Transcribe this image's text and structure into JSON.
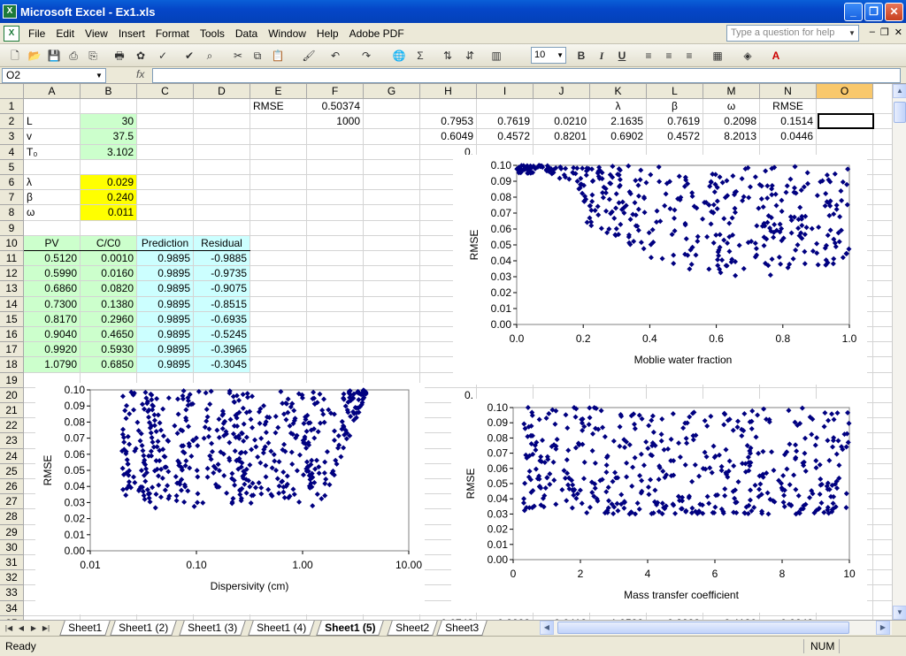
{
  "window": {
    "title": "Microsoft Excel - Ex1.xls",
    "icon": "excel-icon"
  },
  "menu": [
    "File",
    "Edit",
    "View",
    "Insert",
    "Format",
    "Tools",
    "Data",
    "Window",
    "Help",
    "Adobe PDF"
  ],
  "ask_placeholder": "Type a question for help",
  "toolbar": {
    "font_size": "10",
    "bold": "B",
    "italic": "I",
    "underline": "U",
    "sum": "Σ"
  },
  "formula": {
    "name_box": "O2",
    "fx": "fx",
    "content": ""
  },
  "columns": [
    "A",
    "B",
    "C",
    "D",
    "E",
    "F",
    "G",
    "H",
    "I",
    "J",
    "K",
    "L",
    "M",
    "N",
    "O"
  ],
  "selected_column": "O",
  "cells": [
    {
      "ref": "E1",
      "text": "RMSE"
    },
    {
      "ref": "F1",
      "text": "0.50374",
      "align": "r"
    },
    {
      "ref": "K1",
      "text": "λ",
      "align": "c"
    },
    {
      "ref": "L1",
      "text": "β",
      "align": "c"
    },
    {
      "ref": "M1",
      "text": "ω",
      "align": "c"
    },
    {
      "ref": "N1",
      "text": "RMSE",
      "align": "c"
    },
    {
      "ref": "A2",
      "text": "L"
    },
    {
      "ref": "B2",
      "text": "30",
      "align": "r",
      "fill": "#ccffcc"
    },
    {
      "ref": "F2",
      "text": "1000",
      "align": "r"
    },
    {
      "ref": "H2",
      "text": "0.7953",
      "align": "r"
    },
    {
      "ref": "I2",
      "text": "0.7619",
      "align": "r"
    },
    {
      "ref": "J2",
      "text": "0.0210",
      "align": "r"
    },
    {
      "ref": "K2",
      "text": "2.1635",
      "align": "r"
    },
    {
      "ref": "L2",
      "text": "0.7619",
      "align": "r"
    },
    {
      "ref": "M2",
      "text": "0.2098",
      "align": "r"
    },
    {
      "ref": "N2",
      "text": "0.1514",
      "align": "r"
    },
    {
      "ref": "A3",
      "text": "v"
    },
    {
      "ref": "B3",
      "text": "37.5",
      "align": "r",
      "fill": "#ccffcc"
    },
    {
      "ref": "H3",
      "text": "0.6049",
      "align": "r"
    },
    {
      "ref": "I3",
      "text": "0.4572",
      "align": "r"
    },
    {
      "ref": "J3",
      "text": "0.8201",
      "align": "r"
    },
    {
      "ref": "K3",
      "text": "0.6902",
      "align": "r"
    },
    {
      "ref": "L3",
      "text": "0.4572",
      "align": "r"
    },
    {
      "ref": "M3",
      "text": "8.2013",
      "align": "r"
    },
    {
      "ref": "N3",
      "text": "0.0446",
      "align": "r"
    },
    {
      "ref": "A4",
      "text": "T₀"
    },
    {
      "ref": "B4",
      "text": "3.102",
      "align": "r",
      "fill": "#ccffcc"
    },
    {
      "ref": "A6",
      "text": "λ"
    },
    {
      "ref": "B6",
      "text": "0.029",
      "align": "r",
      "fill": "#ffff00"
    },
    {
      "ref": "A7",
      "text": "β"
    },
    {
      "ref": "B7",
      "text": "0.240",
      "align": "r",
      "fill": "#ffff00"
    },
    {
      "ref": "A8",
      "text": "ω"
    },
    {
      "ref": "B8",
      "text": "0.011",
      "align": "r",
      "fill": "#ffff00"
    },
    {
      "ref": "A10",
      "text": "PV",
      "align": "c",
      "fill": "#ccffcc"
    },
    {
      "ref": "B10",
      "text": "C/C0",
      "align": "c",
      "fill": "#ccffcc"
    },
    {
      "ref": "C10",
      "text": "Prediction",
      "align": "c",
      "fill": "#ccffff"
    },
    {
      "ref": "D10",
      "text": "Residual",
      "align": "c",
      "fill": "#ccffff"
    },
    {
      "ref": "A11",
      "text": "0.5120",
      "align": "r",
      "fill": "#ccffcc"
    },
    {
      "ref": "B11",
      "text": "0.0010",
      "align": "r",
      "fill": "#ccffcc"
    },
    {
      "ref": "C11",
      "text": "0.9895",
      "align": "r",
      "fill": "#ccffff"
    },
    {
      "ref": "D11",
      "text": "-0.9885",
      "align": "r",
      "fill": "#ccffff"
    },
    {
      "ref": "A12",
      "text": "0.5990",
      "align": "r",
      "fill": "#ccffcc"
    },
    {
      "ref": "B12",
      "text": "0.0160",
      "align": "r",
      "fill": "#ccffcc"
    },
    {
      "ref": "C12",
      "text": "0.9895",
      "align": "r",
      "fill": "#ccffff"
    },
    {
      "ref": "D12",
      "text": "-0.9735",
      "align": "r",
      "fill": "#ccffff"
    },
    {
      "ref": "A13",
      "text": "0.6860",
      "align": "r",
      "fill": "#ccffcc"
    },
    {
      "ref": "B13",
      "text": "0.0820",
      "align": "r",
      "fill": "#ccffcc"
    },
    {
      "ref": "C13",
      "text": "0.9895",
      "align": "r",
      "fill": "#ccffff"
    },
    {
      "ref": "D13",
      "text": "-0.9075",
      "align": "r",
      "fill": "#ccffff"
    },
    {
      "ref": "A14",
      "text": "0.7300",
      "align": "r",
      "fill": "#ccffcc"
    },
    {
      "ref": "B14",
      "text": "0.1380",
      "align": "r",
      "fill": "#ccffcc"
    },
    {
      "ref": "C14",
      "text": "0.9895",
      "align": "r",
      "fill": "#ccffff"
    },
    {
      "ref": "D14",
      "text": "-0.8515",
      "align": "r",
      "fill": "#ccffff"
    },
    {
      "ref": "A15",
      "text": "0.8170",
      "align": "r",
      "fill": "#ccffcc"
    },
    {
      "ref": "B15",
      "text": "0.2960",
      "align": "r",
      "fill": "#ccffcc"
    },
    {
      "ref": "C15",
      "text": "0.9895",
      "align": "r",
      "fill": "#ccffff"
    },
    {
      "ref": "D15",
      "text": "-0.6935",
      "align": "r",
      "fill": "#ccffff"
    },
    {
      "ref": "A16",
      "text": "0.9040",
      "align": "r",
      "fill": "#ccffcc"
    },
    {
      "ref": "B16",
      "text": "0.4650",
      "align": "r",
      "fill": "#ccffcc"
    },
    {
      "ref": "C16",
      "text": "0.9895",
      "align": "r",
      "fill": "#ccffff"
    },
    {
      "ref": "D16",
      "text": "-0.5245",
      "align": "r",
      "fill": "#ccffff"
    },
    {
      "ref": "A17",
      "text": "0.9920",
      "align": "r",
      "fill": "#ccffcc"
    },
    {
      "ref": "B17",
      "text": "0.5930",
      "align": "r",
      "fill": "#ccffcc"
    },
    {
      "ref": "C17",
      "text": "0.9895",
      "align": "r",
      "fill": "#ccffff"
    },
    {
      "ref": "D17",
      "text": "-0.3965",
      "align": "r",
      "fill": "#ccffff"
    },
    {
      "ref": "A18",
      "text": "1.0790",
      "align": "r",
      "fill": "#ccffcc"
    },
    {
      "ref": "B18",
      "text": "0.6850",
      "align": "r",
      "fill": "#ccffcc"
    },
    {
      "ref": "C18",
      "text": "0.9895",
      "align": "r",
      "fill": "#ccffff"
    },
    {
      "ref": "D18",
      "text": "-0.3045",
      "align": "r",
      "fill": "#ccffff"
    },
    {
      "ref": "H4",
      "text": "0.",
      "align": "r"
    },
    {
      "ref": "H5",
      "text": "0.",
      "align": "r"
    },
    {
      "ref": "H6",
      "text": "0.",
      "align": "r"
    },
    {
      "ref": "H7",
      "text": "0.",
      "align": "r"
    },
    {
      "ref": "H8",
      "text": "0.",
      "align": "r"
    },
    {
      "ref": "H9",
      "text": "0.",
      "align": "r"
    },
    {
      "ref": "H10",
      "text": "0.",
      "align": "r"
    },
    {
      "ref": "H11",
      "text": "0.",
      "align": "r"
    },
    {
      "ref": "H12",
      "text": "0.",
      "align": "r"
    },
    {
      "ref": "H13",
      "text": "0.",
      "align": "r"
    },
    {
      "ref": "H14",
      "text": "0.",
      "align": "r"
    },
    {
      "ref": "H15",
      "text": "0.",
      "align": "r"
    },
    {
      "ref": "H16",
      "text": "0.",
      "align": "r"
    },
    {
      "ref": "H17",
      "text": "0.",
      "align": "r"
    },
    {
      "ref": "H18",
      "text": "0.",
      "align": "r"
    },
    {
      "ref": "H19",
      "text": "0.",
      "align": "r"
    },
    {
      "ref": "H20",
      "text": "0.",
      "align": "r"
    },
    {
      "ref": "H21",
      "text": "0.",
      "align": "r"
    },
    {
      "ref": "H22",
      "text": "0.",
      "align": "r"
    },
    {
      "ref": "H23",
      "text": "0.",
      "align": "r"
    },
    {
      "ref": "H24",
      "text": "0.",
      "align": "r"
    },
    {
      "ref": "H25",
      "text": "0.",
      "align": "r"
    },
    {
      "ref": "H26",
      "text": "0.",
      "align": "r"
    },
    {
      "ref": "H27",
      "text": "0.",
      "align": "r"
    },
    {
      "ref": "H28",
      "text": "0.",
      "align": "r"
    },
    {
      "ref": "H29",
      "text": "0.",
      "align": "r"
    },
    {
      "ref": "H30",
      "text": "0.",
      "align": "r"
    },
    {
      "ref": "H31",
      "text": "0.",
      "align": "r"
    },
    {
      "ref": "H32",
      "text": "0.",
      "align": "r"
    },
    {
      "ref": "H33",
      "text": "0.",
      "align": "r"
    },
    {
      "ref": "H34",
      "text": "0.",
      "align": "r"
    }
  ],
  "chart_data": [
    {
      "type": "scatter",
      "name": "chart-mobile-water",
      "xlabel": "Moblie water fraction",
      "ylabel": "RMSE",
      "xlim": [
        0,
        1
      ],
      "ylim": [
        0,
        0.1
      ],
      "xticks": [
        "0.0",
        "0.2",
        "0.4",
        "0.6",
        "0.8",
        "1.0"
      ],
      "yticks": [
        "0.00",
        "0.01",
        "0.02",
        "0.03",
        "0.04",
        "0.05",
        "0.06",
        "0.07",
        "0.08",
        "0.09",
        "0.10"
      ],
      "marker_color": "#000080",
      "log_x": false,
      "pattern": "u",
      "seed": 11,
      "n": 420
    },
    {
      "type": "scatter",
      "name": "chart-dispersivity",
      "xlabel": "Dispersivity (cm)",
      "ylabel": "RMSE",
      "xlim": [
        0.01,
        10
      ],
      "ylim": [
        0,
        0.1
      ],
      "xticks": [
        "0.01",
        "0.10",
        "1.00",
        "10.00"
      ],
      "yticks": [
        "0.00",
        "0.01",
        "0.02",
        "0.03",
        "0.04",
        "0.05",
        "0.06",
        "0.07",
        "0.08",
        "0.09",
        "0.10"
      ],
      "marker_color": "#000080",
      "log_x": true,
      "pattern": "disp",
      "seed": 7,
      "n": 520
    },
    {
      "type": "scatter",
      "name": "chart-mass-transfer",
      "xlabel": "Mass transfer coefficient",
      "ylabel": "RMSE",
      "xlim": [
        0,
        10
      ],
      "ylim": [
        0,
        0.1
      ],
      "xticks": [
        "0",
        "2",
        "4",
        "6",
        "8",
        "10"
      ],
      "yticks": [
        "0.00",
        "0.01",
        "0.02",
        "0.03",
        "0.04",
        "0.05",
        "0.06",
        "0.07",
        "0.08",
        "0.09",
        "0.10"
      ],
      "marker_color": "#000080",
      "log_x": false,
      "pattern": "mt",
      "seed": 3,
      "n": 480
    }
  ],
  "row_numbers": [
    1,
    2,
    3,
    4,
    5,
    6,
    7,
    8,
    9,
    10,
    11,
    12,
    13,
    14,
    15,
    16,
    17,
    18,
    19,
    20,
    21,
    22,
    23,
    24,
    25,
    26,
    27,
    28,
    29,
    30,
    31,
    32,
    33,
    34,
    35
  ],
  "partial_row_35": [
    "0.6748",
    "0.8883",
    "0.6418",
    "1.0582",
    "0.8883",
    "6.4180",
    "0.0242"
  ],
  "sheets": [
    "Sheet1",
    "Sheet1 (2)",
    "Sheet1 (3)",
    "Sheet1 (4)",
    "Sheet1 (5)",
    "Sheet2",
    "Sheet3"
  ],
  "active_sheet": "Sheet1 (5)",
  "status": {
    "ready": "Ready",
    "num": "NUM"
  }
}
